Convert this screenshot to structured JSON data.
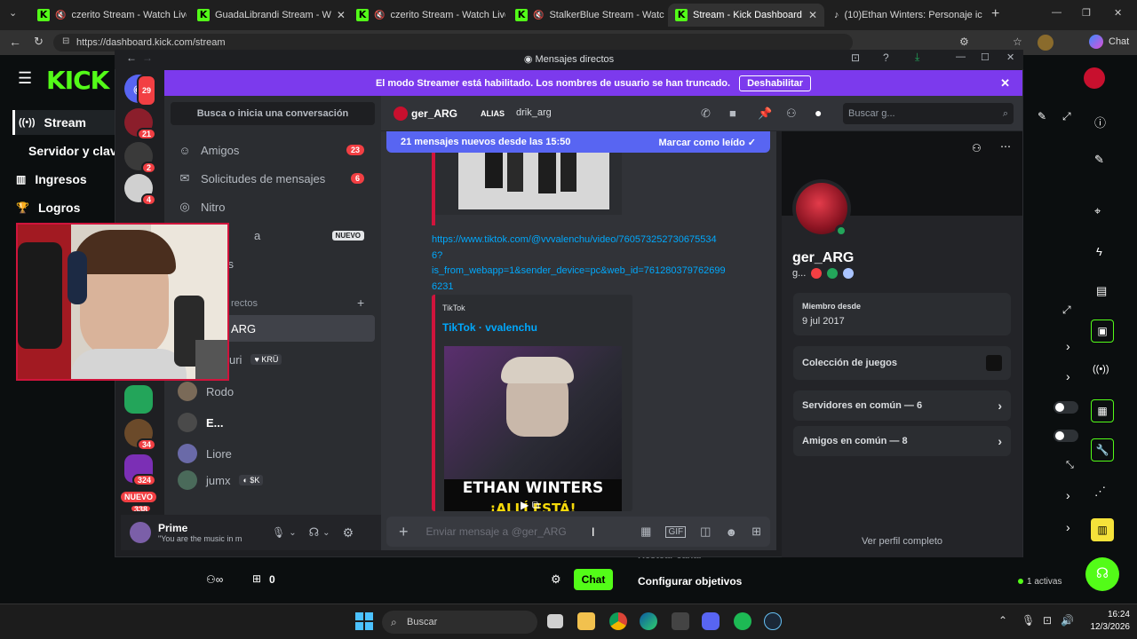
{
  "browser": {
    "tabs": [
      {
        "label": "czerito Stream - Watch Live",
        "muted": true
      },
      {
        "label": "GuadaLibrandi Stream - W",
        "muted": false
      },
      {
        "label": "czerito Stream - Watch Live",
        "muted": true
      },
      {
        "label": "StalkerBlue Stream - Watch",
        "muted": true
      },
      {
        "label": "Stream - Kick Dashboard",
        "active": true
      },
      {
        "label": "(10)Ethan Winters: Personaje ic",
        "muted": false
      }
    ],
    "url": "https://dashboard.kick.com/stream",
    "profile_label": "Chat"
  },
  "kick": {
    "logo": "KICK",
    "nav": [
      {
        "label": "Stream",
        "icon": "broadcast-icon",
        "active": true
      },
      {
        "label": "Servidor y clave",
        "icon": "",
        "active": false
      },
      {
        "label": "Ingresos",
        "icon": "chart-icon",
        "active": false
      },
      {
        "label": "Logros",
        "icon": "trophy-icon",
        "active": false
      }
    ],
    "bottom": {
      "viewer_count": "0",
      "chat_button": "Chat",
      "configure_goals": "Configurar objetivos",
      "activas": "1 activas",
      "faded_label": "Restear canal"
    }
  },
  "discord": {
    "window_title": "Mensajes directos",
    "streamer_banner": {
      "text": "El modo Streamer está habilitado. Los nombres de usuario se han truncado.",
      "button": "Deshabilitar"
    },
    "guilds": [
      {
        "badge": "29"
      },
      {
        "badge": "21"
      },
      {
        "badge": "2"
      },
      {
        "badge": "4"
      },
      {
        "badge": ""
      },
      {
        "badge": ""
      },
      {
        "badge": "34"
      },
      {
        "badge": "324"
      }
    ],
    "guild_new_label": "NUEVO",
    "guild_partial_badge": "338",
    "dm_search": "Busca o inicia una conversación",
    "dm_nav": [
      {
        "label": "Amigos",
        "icon": "friends-icon",
        "badge": "23"
      },
      {
        "label": "Solicitudes de mensajes",
        "icon": "mail-icon",
        "badge": "6"
      },
      {
        "label": "Nitro",
        "icon": "nitro-icon",
        "badge": ""
      },
      {
        "label": "a",
        "icon": "shop-icon",
        "new": "NUEVO"
      },
      {
        "label": "nes",
        "icon": "quests-icon",
        "badge": ""
      }
    ],
    "dm_section": "rectos",
    "dm_users": [
      {
        "name": "ARG",
        "tag": ""
      },
      {
        "name": "uri",
        "tag": "KRÜ"
      },
      {
        "name": "Rodo",
        "tag": ""
      },
      {
        "name": "E...",
        "tag": ""
      },
      {
        "name": "Liore",
        "tag": ""
      },
      {
        "name": "jumx",
        "tag": "$K"
      }
    ],
    "user_panel": {
      "name": "Prime",
      "status": "\"You are the music in m"
    },
    "chat": {
      "username": "ger_ARG",
      "alias_label": "ALIAS",
      "alias": "drik_arg",
      "search_placeholder": "Buscar g...",
      "new_messages": "21 mensajes nuevos desde las 15:50",
      "mark_read": "Marcar como leído",
      "link": "https://www.tiktok.com/@vvvalenchu/video/7605732527306755346?is_from_webapp=1&sender_device=pc&web_id=7612803797626996231",
      "link_lines": [
        "https://www.tiktok.com/@vvvalenchu/video/760573252730675534",
        "6?",
        "is_from_webapp=1&sender_device=pc&web_id=761280379762699",
        "6231"
      ],
      "embed_provider": "TikTok",
      "embed_title": "TikTok · vvalenchu",
      "embed_caption": "ETHAN WINTERS",
      "embed_caption2": "¡ALLÍ ESTÁ!",
      "composer_placeholder": "Enviar mensaje a @ger_ARG"
    },
    "profile": {
      "username": "ger_ARG",
      "sub": "g...",
      "member_since_label": "Miembro desde",
      "member_since": "9 jul 2017",
      "games_label": "Colección de juegos",
      "servers_common": "Servidores en común — 6",
      "friends_common": "Amigos en común — 8",
      "view_full": "Ver perfil completo"
    }
  },
  "taskbar": {
    "search": "Buscar",
    "time": "16:24",
    "date": "12/3/2026"
  },
  "colors": {
    "kick_green": "#53fc18",
    "discord_blurple": "#5865f2",
    "streamer_banner": "#7c3aed",
    "badge_red": "#f23f43"
  }
}
